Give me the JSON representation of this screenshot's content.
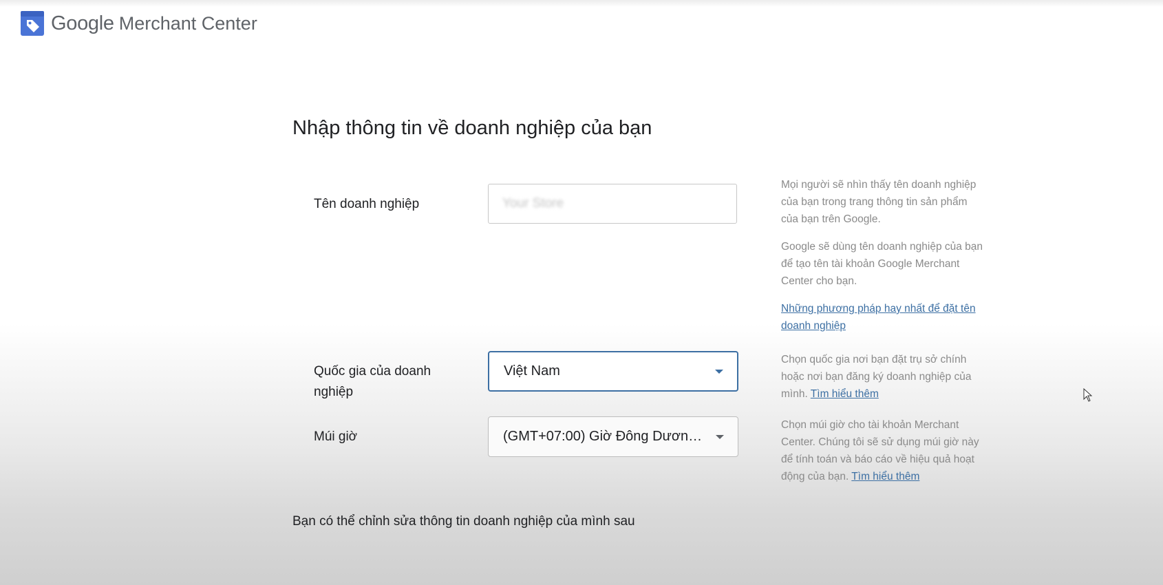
{
  "header": {
    "brand_google": "Google",
    "brand_product": "Merchant Center",
    "logo_icon": "merchant-center-tag-icon"
  },
  "page": {
    "title": "Nhập thông tin về doanh nghiệp của bạn",
    "footer_note": "Bạn có thể chỉnh sửa thông tin doanh nghiệp của mình sau"
  },
  "fields": {
    "business_name": {
      "label": "Tên doanh nghiệp",
      "value": "",
      "placeholder": "Your Store"
    },
    "country": {
      "label": "Quốc gia của doanh nghiệp",
      "selected": "Việt Nam"
    },
    "timezone": {
      "label": "Múi giờ",
      "selected": "(GMT+07:00) Giờ Đông Dương (..."
    }
  },
  "help": {
    "business_name_p1": "Mọi người sẽ nhìn thấy tên doanh nghiệp của bạn trong trang thông tin sản phẩm của bạn trên Google.",
    "business_name_p2": "Google sẽ dùng tên doanh nghiệp của bạn để tạo tên tài khoản Google Merchant Center cho bạn.",
    "business_name_link": "Những phương pháp hay nhất để đặt tên doanh nghiệp",
    "country_text": "Chọn quốc gia nơi bạn đặt trụ sở chính hoặc nơi bạn đăng ký doanh nghiệp của mình.",
    "country_link": "Tìm hiểu thêm",
    "timezone_text": "Chọn múi giờ cho tài khoản Merchant Center. Chúng tôi sẽ sử dụng múi giờ này để tính toán và báo cáo về hiệu quả hoạt động của bạn.",
    "timezone_link": "Tìm hiểu thêm"
  },
  "colors": {
    "accent": "#3c6fa3",
    "logo_blue": "#4a74d6",
    "help_text": "#8a8a8a"
  }
}
